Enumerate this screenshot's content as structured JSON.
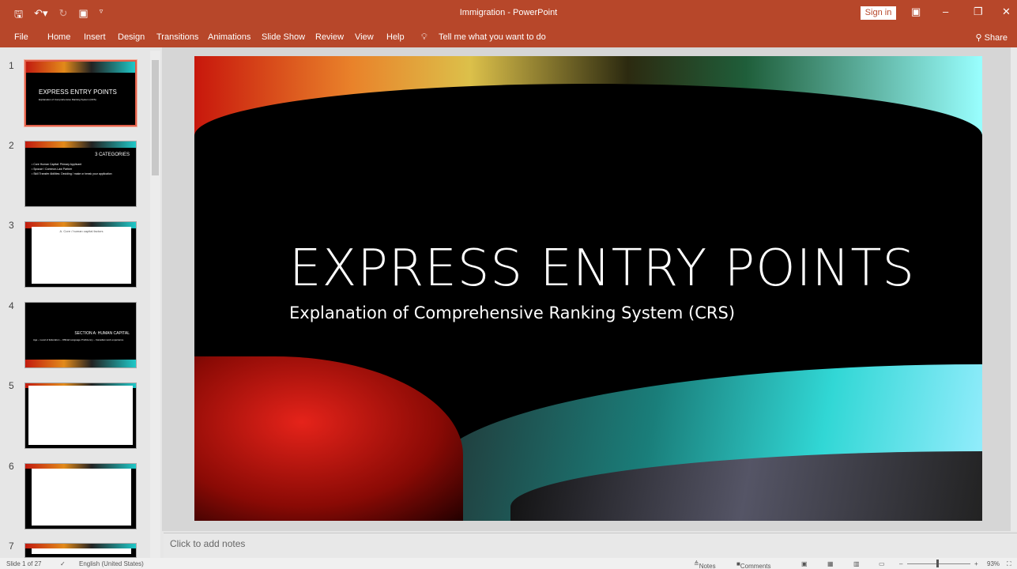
{
  "window": {
    "title": "Immigration  -  PowerPoint",
    "sign_in": "Sign in"
  },
  "ribbon": {
    "tabs": [
      "File",
      "Home",
      "Insert",
      "Design",
      "Transitions",
      "Animations",
      "Slide Show",
      "Review",
      "View",
      "Help"
    ],
    "tell_me": "Tell me what you want to do",
    "share": "Share"
  },
  "thumbnails": [
    {
      "num": "1",
      "title": "EXPRESS ENTRY POINTS",
      "subtitle": "Explanation of Comprehensive Ranking System (CRS)"
    },
    {
      "num": "2",
      "title": "3 CATEGORIES",
      "bullets": [
        "• Core Human Capital: Primary Applicant",
        "• Spouse / Common-Law Partner",
        "• Skill Transfer Abilities: Deciding / make or break your application"
      ]
    },
    {
      "num": "3",
      "title": "A. Core / human capital factors"
    },
    {
      "num": "4",
      "title": "SECTION A: HUMAN CAPITAL",
      "subtitle": "Age – Level of Education – Official Language Proficiency – Canadian work experience"
    },
    {
      "num": "5"
    },
    {
      "num": "6"
    },
    {
      "num": "7"
    }
  ],
  "slide": {
    "title": "EXPRESS ENTRY POINTS",
    "subtitle": "Explanation of Comprehensive Ranking System (CRS)"
  },
  "notes": {
    "placeholder": "Click to add notes"
  },
  "status": {
    "slide": "Slide 1 of 27",
    "language": "English (United States)",
    "notes": "Notes",
    "comments": "Comments",
    "zoom": "93%"
  }
}
